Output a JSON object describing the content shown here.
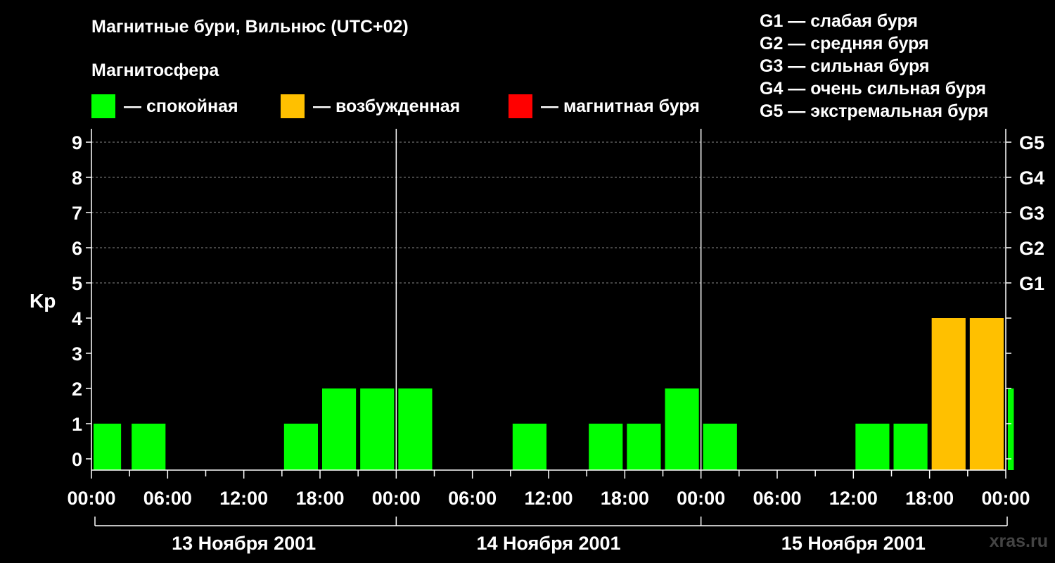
{
  "header": {
    "title": "Магнитные бури, Вильнюс (UTC+02)",
    "subtitle": "Магнитосфера"
  },
  "legend": [
    {
      "label": "— спокойная",
      "color": "#00ff00"
    },
    {
      "label": "— возбужденная",
      "color": "#ffc000"
    },
    {
      "label": "— магнитная буря",
      "color": "#ff0000"
    }
  ],
  "g_levels": [
    "G1 — слабая буря",
    "G2 — средняя буря",
    "G3 — сильная буря",
    "G4 — очень сильная буря",
    "G5 — экстремальная буря"
  ],
  "watermark": "xras.ru",
  "chart_data": {
    "type": "bar",
    "ylabel": "Kp",
    "ylim": [
      0,
      9
    ],
    "yticks": [
      0,
      1,
      2,
      3,
      4,
      5,
      6,
      7,
      8,
      9
    ],
    "right_axis_labels": [
      {
        "kp": 5,
        "label": "G1"
      },
      {
        "kp": 6,
        "label": "G2"
      },
      {
        "kp": 7,
        "label": "G3"
      },
      {
        "kp": 8,
        "label": "G4"
      },
      {
        "kp": 9,
        "label": "G5"
      }
    ],
    "grid": "dashed horizontal at Kp 5–9",
    "x_tick_labels": [
      "00:00",
      "06:00",
      "12:00",
      "18:00",
      "00:00",
      "06:00",
      "12:00",
      "18:00",
      "00:00",
      "06:00",
      "12:00",
      "18:00",
      "00:00"
    ],
    "days": [
      "13 Ноября 2001",
      "14 Ноября 2001",
      "15 Ноября 2001"
    ],
    "colors": {
      "quiet": "#00ff00",
      "active": "#ffc000",
      "storm": "#ff0000"
    },
    "bars": [
      {
        "start_hour": 0,
        "end_hour": 2.5,
        "kp": 1,
        "level": "quiet"
      },
      {
        "start_hour": 3,
        "end_hour": 6,
        "kp": 1,
        "level": "quiet"
      },
      {
        "start_hour": 15,
        "end_hour": 18,
        "kp": 1,
        "level": "quiet"
      },
      {
        "start_hour": 18,
        "end_hour": 21,
        "kp": 2,
        "level": "quiet"
      },
      {
        "start_hour": 21,
        "end_hour": 24,
        "kp": 2,
        "level": "quiet"
      },
      {
        "start_hour": 24,
        "end_hour": 27,
        "kp": 2,
        "level": "quiet"
      },
      {
        "start_hour": 33,
        "end_hour": 36,
        "kp": 1,
        "level": "quiet"
      },
      {
        "start_hour": 39,
        "end_hour": 42,
        "kp": 1,
        "level": "quiet"
      },
      {
        "start_hour": 42,
        "end_hour": 45,
        "kp": 1,
        "level": "quiet"
      },
      {
        "start_hour": 45,
        "end_hour": 48,
        "kp": 2,
        "level": "quiet"
      },
      {
        "start_hour": 48,
        "end_hour": 51,
        "kp": 1,
        "level": "quiet"
      },
      {
        "start_hour": 60,
        "end_hour": 63,
        "kp": 1,
        "level": "quiet"
      },
      {
        "start_hour": 63,
        "end_hour": 66,
        "kp": 1,
        "level": "quiet"
      },
      {
        "start_hour": 66,
        "end_hour": 69,
        "kp": 4,
        "level": "active"
      },
      {
        "start_hour": 69,
        "end_hour": 72,
        "kp": 4,
        "level": "active"
      },
      {
        "start_hour": 72,
        "end_hour": 72.8,
        "kp": 2,
        "level": "quiet"
      }
    ]
  }
}
